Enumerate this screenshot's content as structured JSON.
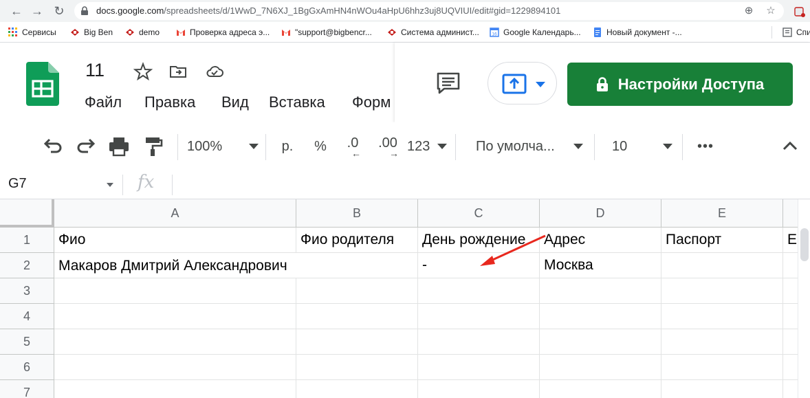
{
  "browser": {
    "url_host": "docs.google.com",
    "url_path": "/spreadsheets/d/1WwD_7N6XJ_1BgGxAmHN4nWOu4aHpU6hhz3uj8UQVIUI/edit#gid=1229894101",
    "bookmarks": [
      {
        "label": "Сервисы",
        "icon": "apps-grid-icon"
      },
      {
        "label": "Big Ben",
        "icon": "bigben-favicon"
      },
      {
        "label": "demo",
        "icon": "bigben-favicon"
      },
      {
        "label": "Проверка адреса э...",
        "icon": "gmail-icon"
      },
      {
        "label": "\"support@bigbencr...",
        "icon": "gmail-icon"
      },
      {
        "label": "Система админист...",
        "icon": "bigben-favicon"
      },
      {
        "label": "Google Календарь...",
        "icon": "calendar-icon"
      },
      {
        "label": "Новый документ -...",
        "icon": "docs-icon"
      },
      {
        "label": "Спи",
        "icon": "reading-list-icon"
      }
    ]
  },
  "header": {
    "title": "11",
    "menu": [
      "Файл",
      "Правка",
      "Вид",
      "Вставка",
      "Форм"
    ],
    "share_label": "Настройки Доступа"
  },
  "toolbar": {
    "zoom": "100%",
    "currency": "р.",
    "percent": "%",
    "dec_decrease": ".0",
    "dec_increase": ".00",
    "format_more": "123",
    "font": "По умолча...",
    "font_size": "10",
    "more": "•••"
  },
  "formula_bar": {
    "name_box": "G7",
    "fx": "fx",
    "value": ""
  },
  "grid": {
    "columns": [
      "A",
      "B",
      "C",
      "D",
      "E"
    ],
    "rows": [
      "1",
      "2",
      "3",
      "4",
      "5",
      "6",
      "7"
    ],
    "cells": {
      "A1": "Фио",
      "B1": "Фио родителя",
      "C1": "День рождение",
      "D1": "Адрес",
      "E1": "Паспорт",
      "F1": "Е",
      "A2": "Макаров Дмитрий Александрович",
      "C2": "-",
      "D2": "Москва"
    }
  },
  "colors": {
    "share_green": "#188038",
    "annotation_red": "#e8281e",
    "sheets_green": "#0f9d58"
  }
}
